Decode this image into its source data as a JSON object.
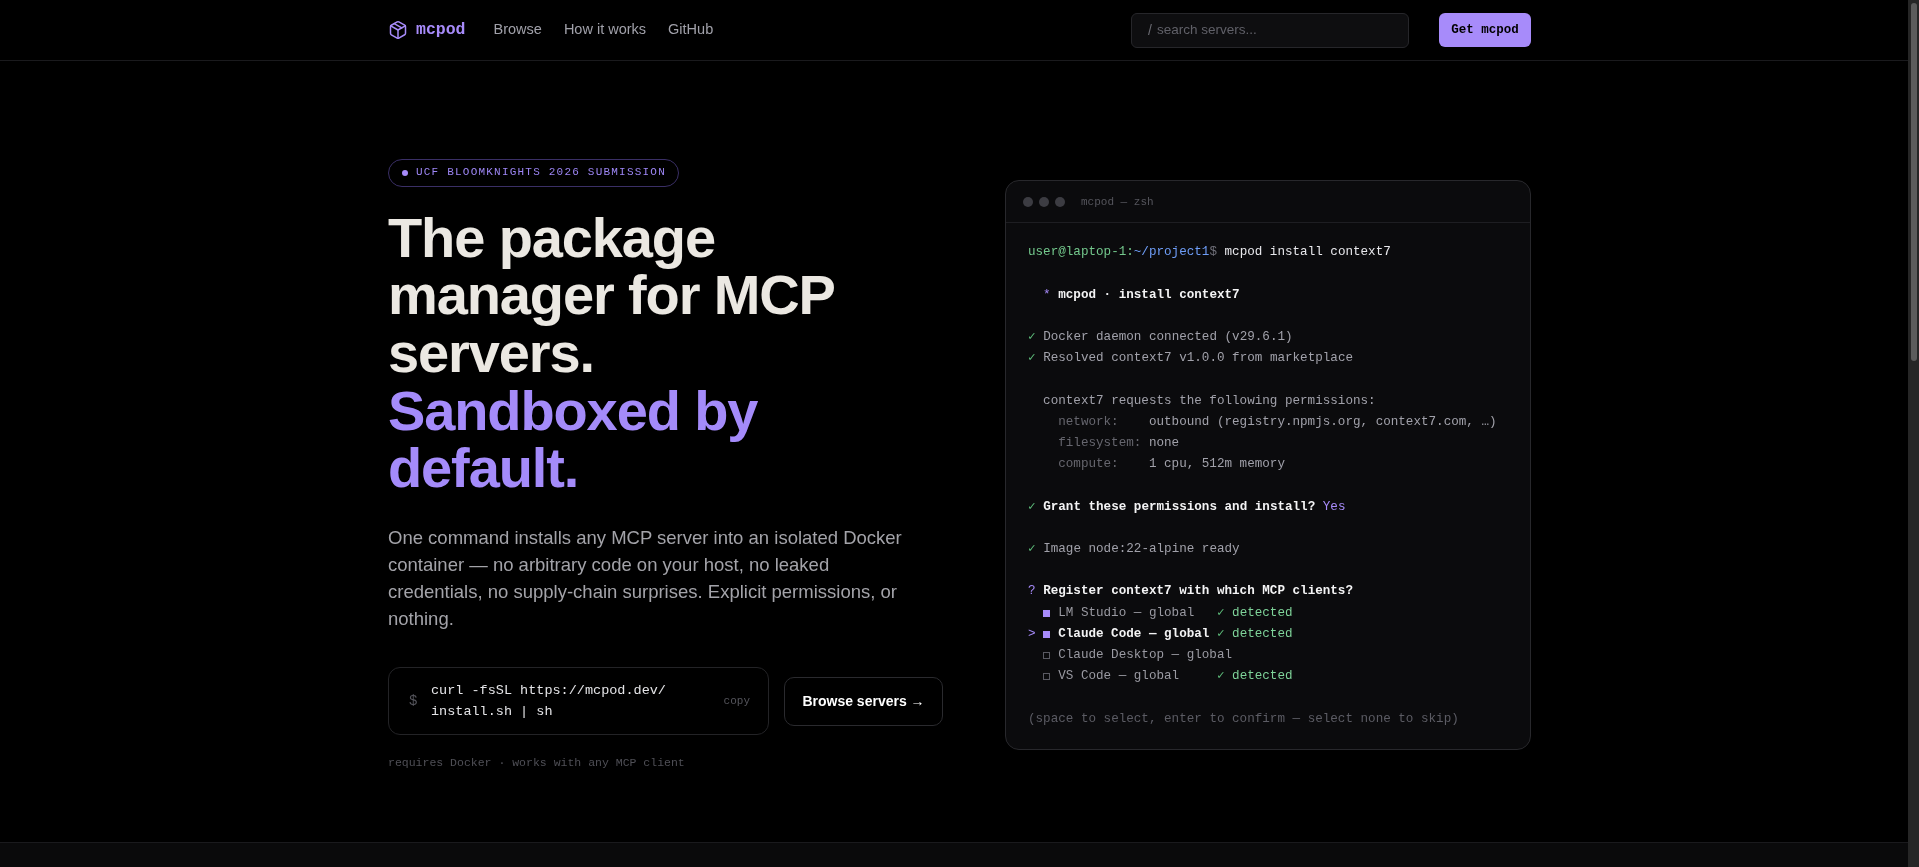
{
  "nav": {
    "logo": "mcpod",
    "links": [
      "Browse",
      "How it works",
      "GitHub"
    ],
    "search": {
      "shortcut": "/",
      "placeholder": "search servers..."
    },
    "cta": "Get mcpod"
  },
  "hero": {
    "badge": "UCF BLOOMKNIGHTS 2026 SUBMISSION",
    "heading": "The package manager for MCP servers.",
    "heading_accent": "Sandboxed by default.",
    "description": "One command installs any MCP server into an isolated Docker container — no arbitrary code on your host, no leaked credentials, no supply-chain surprises. Explicit permissions, or nothing.",
    "install": {
      "prompt": "$",
      "command": "curl -fsSL https://mcpod.dev/install.sh | sh",
      "copy": "copy"
    },
    "browse_button": "Browse servers →",
    "note": "requires Docker · works with any MCP client"
  },
  "terminal": {
    "title": "mcpod — zsh",
    "lines": [
      {
        "kind": "prompt",
        "user": "user@laptop-1:",
        "path": "~/project1",
        "symbol": "$",
        "command": "mcpod install context7"
      },
      {
        "kind": "blank"
      },
      {
        "kind": "title",
        "mark": "*",
        "text": "mcpod · install context7"
      },
      {
        "kind": "blank"
      },
      {
        "kind": "check",
        "mark": "✓",
        "text": "Docker daemon connected (v29.6.1)"
      },
      {
        "kind": "check",
        "mark": "✓",
        "text": "Resolved context7 v1.0.0 from marketplace"
      },
      {
        "kind": "blank"
      },
      {
        "kind": "text",
        "text": "context7 requests the following permissions:"
      },
      {
        "kind": "permission",
        "key": "network:",
        "value": "outbound (registry.npmjs.org, context7.com, …)"
      },
      {
        "kind": "permission",
        "key": "filesystem:",
        "value": "none"
      },
      {
        "kind": "permission",
        "key": "compute:",
        "value": "1 cpu, 512m memory"
      },
      {
        "kind": "blank"
      },
      {
        "kind": "confirm",
        "mark": "✓",
        "text": "Grant these permissions and install?",
        "answer": "Yes"
      },
      {
        "kind": "blank"
      },
      {
        "kind": "check",
        "mark": "✓",
        "text": "Image node:22-alpine ready"
      },
      {
        "kind": "blank"
      },
      {
        "kind": "question",
        "mark": "?",
        "text": "Register context7 with which MCP clients?"
      },
      {
        "kind": "options",
        "pointer": ">",
        "items": [
          {
            "label": "LM Studio — global",
            "checked": true,
            "selected": false,
            "status_mark": "✓",
            "status": "detected"
          },
          {
            "label": "Claude Code — global",
            "checked": true,
            "selected": true,
            "status_mark": "✓",
            "status": "detected"
          },
          {
            "label": "Claude Desktop — global",
            "checked": false,
            "selected": false
          },
          {
            "label": "VS Code — global",
            "checked": false,
            "selected": false,
            "status_mark": "✓",
            "status": "detected"
          }
        ]
      },
      {
        "kind": "blank"
      },
      {
        "kind": "hint",
        "text": "(space to select, enter to confirm — select none to skip)"
      }
    ]
  }
}
